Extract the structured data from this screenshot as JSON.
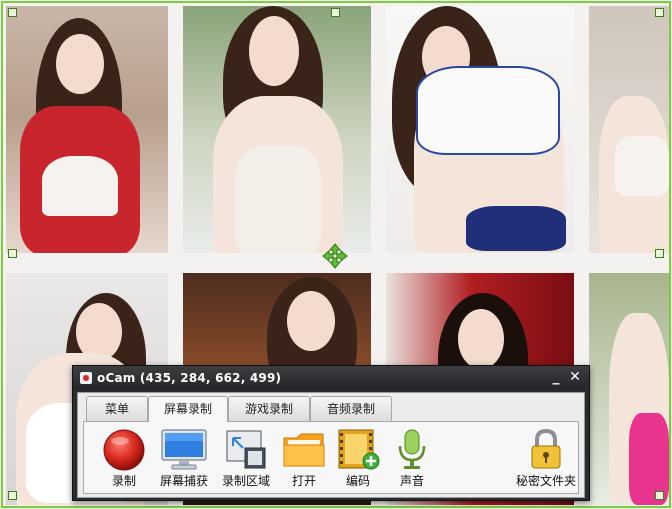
{
  "window": {
    "app_name": "oCam",
    "title": "oCam (435, 284, 662, 499)",
    "minimize_glyph": "_",
    "close_glyph": "✕"
  },
  "tabs": [
    {
      "label": "菜单",
      "active": false
    },
    {
      "label": "屏幕录制",
      "active": true
    },
    {
      "label": "游戏录制",
      "active": false
    },
    {
      "label": "音频录制",
      "active": false
    }
  ],
  "toolbar": [
    {
      "label": "录制",
      "icon": "record-icon"
    },
    {
      "label": "屏幕捕获",
      "icon": "monitor-icon"
    },
    {
      "label": "录制区域",
      "icon": "region-resize-icon"
    },
    {
      "label": "打开",
      "icon": "folder-icon"
    },
    {
      "label": "编码",
      "icon": "film-add-icon"
    },
    {
      "label": "声音",
      "icon": "microphone-icon"
    },
    {
      "label": "秘密文件夹",
      "icon": "padlock-icon"
    }
  ],
  "selection": {
    "border_color": "#7ccc3d",
    "move_icon": "move-arrows-icon"
  },
  "colors": {
    "title_bar": "#2a2b2d",
    "record_red": "#d6281f",
    "accent_green": "#7ccc3d"
  }
}
